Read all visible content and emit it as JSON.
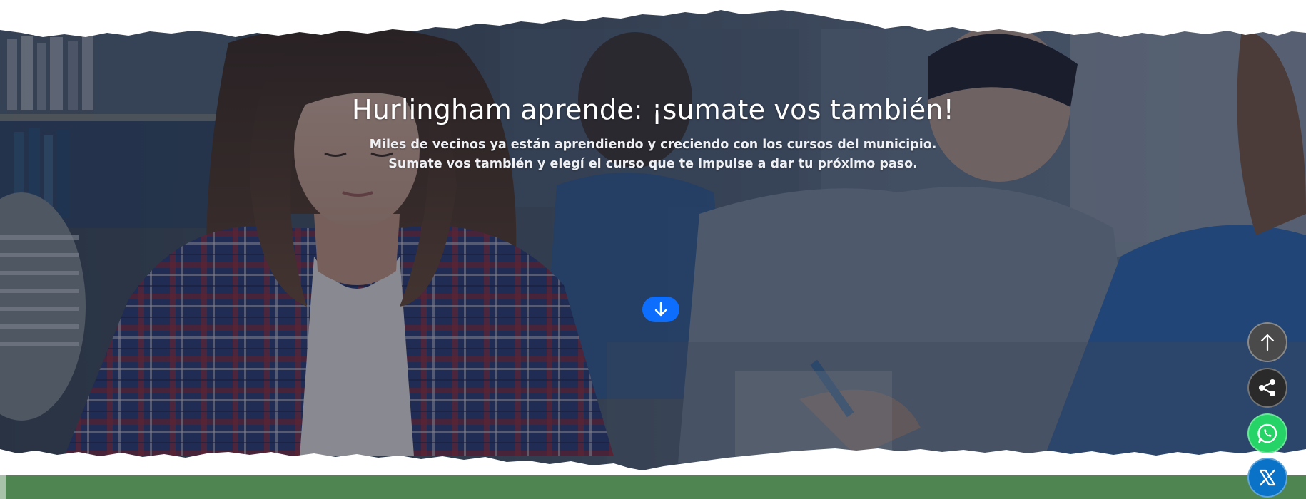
{
  "hero": {
    "title": "Hurlingham aprende: ¡sumate vos también!",
    "subtitle_line1": "Miles de vecinos ya están aprendiendo y creciendo con los cursos del municipio.",
    "subtitle_line2": "Sumate vos también y elegí el curso que te impulse a dar tu próximo paso.",
    "scroll_icon": "arrow-down-icon",
    "accent_color": "#0d6efd"
  },
  "floating_buttons": [
    {
      "name": "back-to-top",
      "icon": "arrow-up-icon",
      "color": "#4a4a4a"
    },
    {
      "name": "share",
      "icon": "share-icon",
      "color": "#2a2a2a"
    },
    {
      "name": "whatsapp",
      "icon": "whatsapp-icon",
      "color": "#25d366"
    },
    {
      "name": "x",
      "icon": "x-logo-icon",
      "color": "#0a73c7"
    }
  ],
  "band_color": "#4f8550"
}
